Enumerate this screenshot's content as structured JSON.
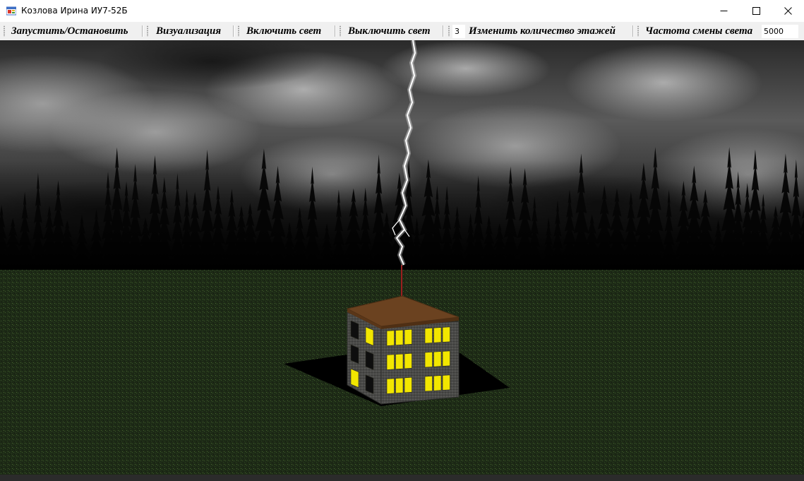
{
  "window": {
    "title": "Козлова Ирина ИУ7-52Б"
  },
  "toolbar": {
    "start_stop_label": "Запустить/Остановить",
    "visualize_label": "Визуализация",
    "light_on_label": "Включить свет",
    "light_off_label": "Выключить свет",
    "floors_value": "3",
    "change_floors_label": "Изменить количество этажей",
    "light_freq_label": "Частота смены света",
    "light_freq_value": "5000"
  },
  "scene": {
    "floors": 3,
    "colors": {
      "sky": "#3a3a3a",
      "grass": "#1f2e17",
      "roof": "#6b4220",
      "wall": "#4a4a48",
      "window_lit": "#f2e600",
      "window_dark": "#0e0e0e",
      "lightning": "#ffffff",
      "rod": "#9a1f1f"
    },
    "icons": [
      "app-icon",
      "minimize-icon",
      "maximize-icon",
      "close-icon"
    ]
  }
}
